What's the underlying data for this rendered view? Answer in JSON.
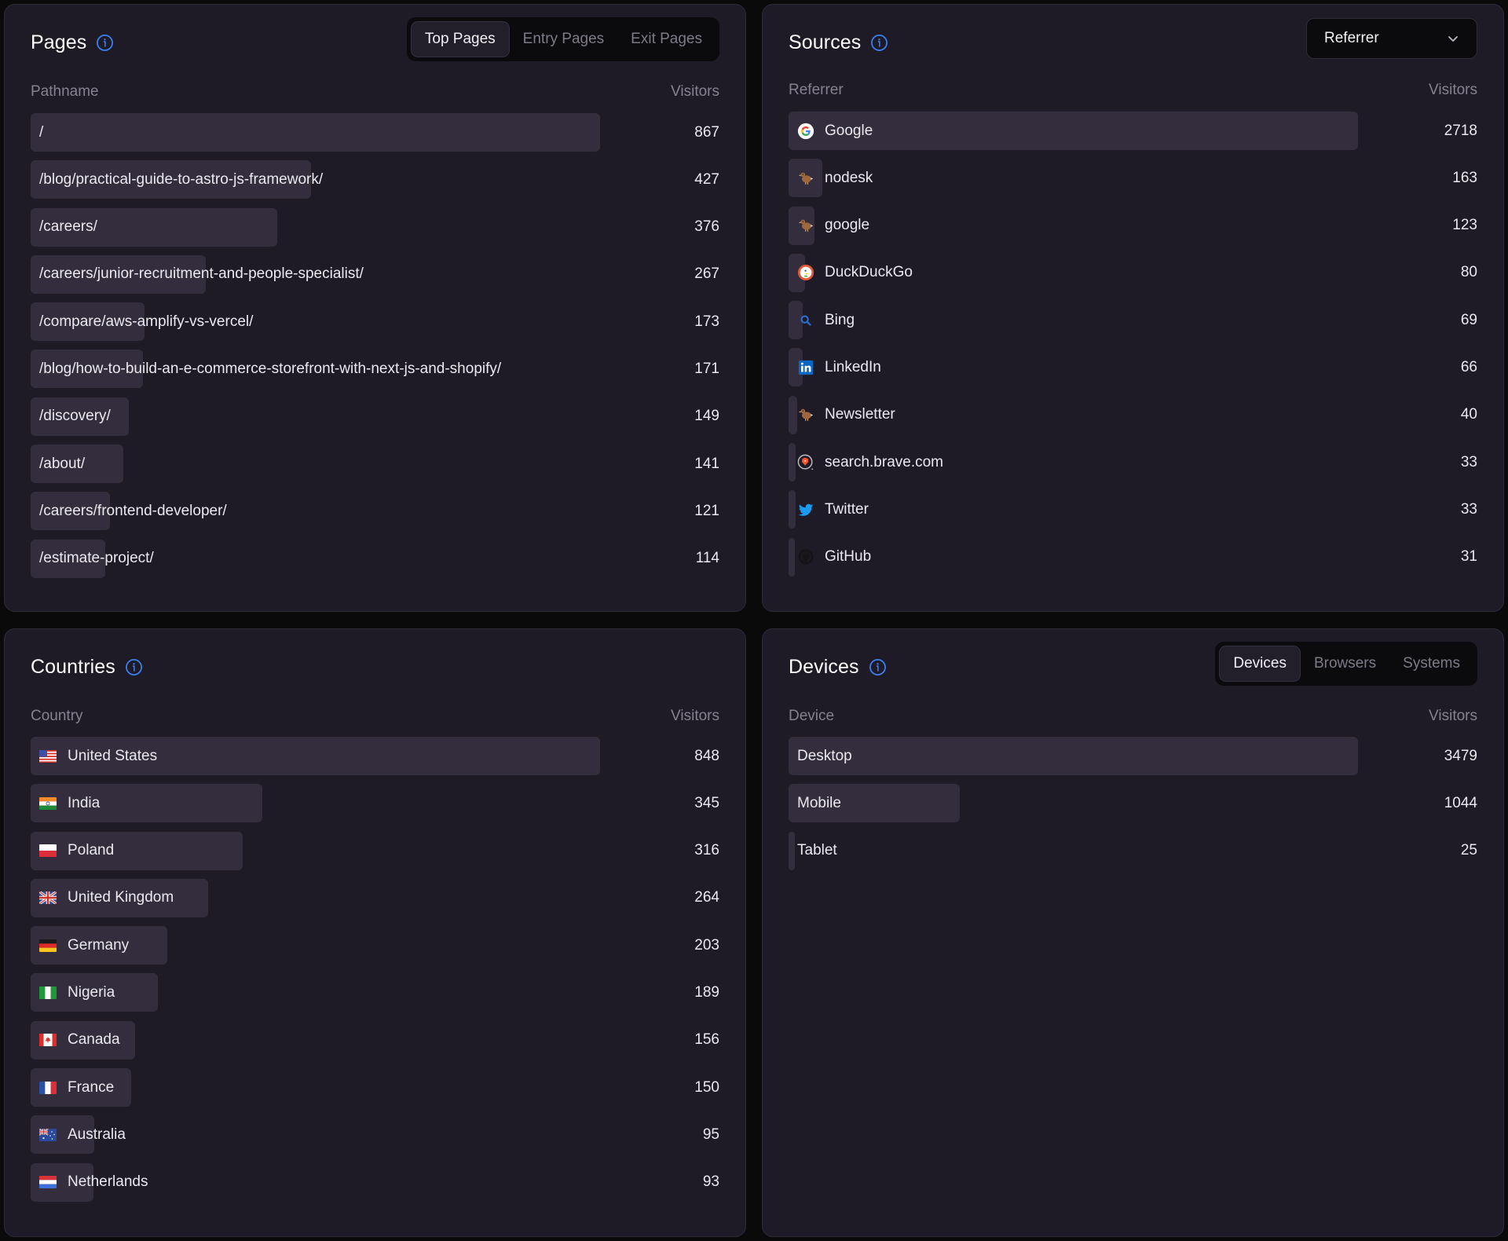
{
  "pages": {
    "title": "Pages",
    "tabs": [
      {
        "label": "Top Pages",
        "active": true
      },
      {
        "label": "Entry Pages",
        "active": false
      },
      {
        "label": "Exit Pages",
        "active": false
      }
    ],
    "col_label": "Pathname",
    "col_value": "Visitors",
    "rows": [
      {
        "label": "/",
        "value": 867
      },
      {
        "label": "/blog/practical-guide-to-astro-js-framework/",
        "value": 427
      },
      {
        "label": "/careers/",
        "value": 376
      },
      {
        "label": "/careers/junior-recruitment-and-people-specialist/",
        "value": 267
      },
      {
        "label": "/compare/aws-amplify-vs-vercel/",
        "value": 173
      },
      {
        "label": "/blog/how-to-build-an-e-commerce-storefront-with-next-js-and-shopify/",
        "value": 171
      },
      {
        "label": "/discovery/",
        "value": 149
      },
      {
        "label": "/about/",
        "value": 141
      },
      {
        "label": "/careers/frontend-developer/",
        "value": 121
      },
      {
        "label": "/estimate-project/",
        "value": 114
      }
    ]
  },
  "sources": {
    "title": "Sources",
    "dropdown_value": "Referrer",
    "col_label": "Referrer",
    "col_value": "Visitors",
    "rows": [
      {
        "label": "Google",
        "value": 2718,
        "icon": "google-icon"
      },
      {
        "label": "nodesk",
        "value": 163,
        "icon": "dodo-icon"
      },
      {
        "label": "google",
        "value": 123,
        "icon": "dodo-icon"
      },
      {
        "label": "DuckDuckGo",
        "value": 80,
        "icon": "duckduckgo-icon"
      },
      {
        "label": "Bing",
        "value": 69,
        "icon": "bing-search-icon"
      },
      {
        "label": "LinkedIn",
        "value": 66,
        "icon": "linkedin-icon"
      },
      {
        "label": "Newsletter",
        "value": 40,
        "icon": "dodo-icon"
      },
      {
        "label": "search.brave.com",
        "value": 33,
        "icon": "brave-icon"
      },
      {
        "label": "Twitter",
        "value": 33,
        "icon": "twitter-icon"
      },
      {
        "label": "GitHub",
        "value": 31,
        "icon": "github-icon"
      }
    ]
  },
  "countries": {
    "title": "Countries",
    "col_label": "Country",
    "col_value": "Visitors",
    "rows": [
      {
        "label": "United States",
        "value": 848,
        "flag": "us"
      },
      {
        "label": "India",
        "value": 345,
        "flag": "in"
      },
      {
        "label": "Poland",
        "value": 316,
        "flag": "pl"
      },
      {
        "label": "United Kingdom",
        "value": 264,
        "flag": "gb"
      },
      {
        "label": "Germany",
        "value": 203,
        "flag": "de"
      },
      {
        "label": "Nigeria",
        "value": 189,
        "flag": "ng"
      },
      {
        "label": "Canada",
        "value": 156,
        "flag": "ca"
      },
      {
        "label": "France",
        "value": 150,
        "flag": "fr"
      },
      {
        "label": "Australia",
        "value": 95,
        "flag": "au"
      },
      {
        "label": "Netherlands",
        "value": 93,
        "flag": "nl"
      }
    ]
  },
  "devices": {
    "title": "Devices",
    "tabs": [
      {
        "label": "Devices",
        "active": true
      },
      {
        "label": "Browsers",
        "active": false
      },
      {
        "label": "Systems",
        "active": false
      }
    ],
    "col_label": "Device",
    "col_value": "Visitors",
    "rows": [
      {
        "label": "Desktop",
        "value": 3479
      },
      {
        "label": "Mobile",
        "value": 1044
      },
      {
        "label": "Tablet",
        "value": 25
      }
    ]
  },
  "colors": {
    "background": "#0a0a0b",
    "panel": "#1f1b26",
    "bar": "#332d3d",
    "info_accent": "#3b82f6"
  }
}
